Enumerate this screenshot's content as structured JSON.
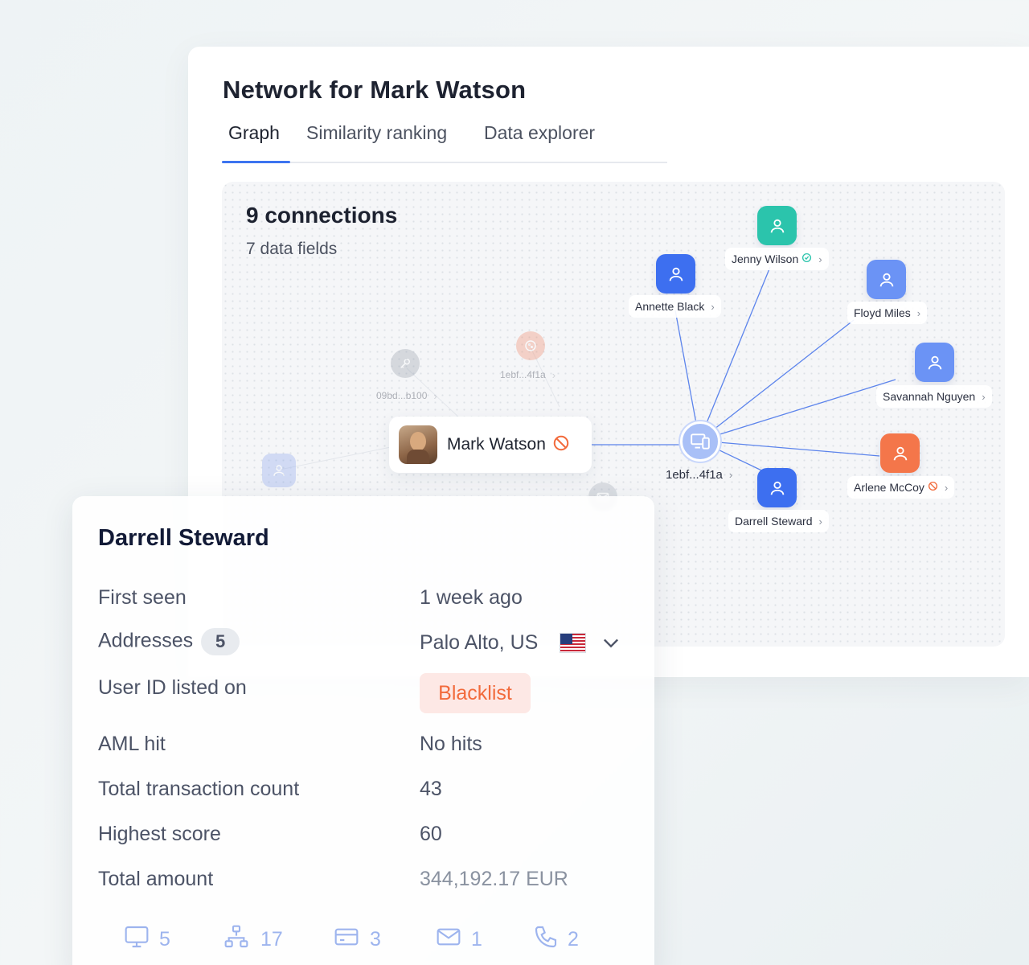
{
  "header": {
    "title": "Network for Mark Watson"
  },
  "tabs": [
    {
      "label": "Graph",
      "active": true
    },
    {
      "label": "Similarity ranking",
      "active": false
    },
    {
      "label": "Data explorer",
      "active": false
    }
  ],
  "graph": {
    "connections_title": "9 connections",
    "data_fields": "7 data fields",
    "center": {
      "name": "Mark Watson",
      "status_icon": "blocked-icon"
    },
    "hub": {
      "label": "1ebf...4f1a",
      "icon": "devices-icon"
    },
    "faded_nodes": [
      {
        "label": "09bd...b100",
        "icon": "key-icon"
      },
      {
        "label": "1ebf...4f1a",
        "icon": "cookie-icon"
      }
    ],
    "nodes": [
      {
        "name": "Jenny Wilson",
        "color": "#2bc4ac",
        "status": "verified"
      },
      {
        "name": "Annette Black",
        "color": "#3d6ff0",
        "status": ""
      },
      {
        "name": "Floyd Miles",
        "color": "#6b93f5",
        "status": ""
      },
      {
        "name": "Savannah Nguyen",
        "color": "#6b93f5",
        "status": ""
      },
      {
        "name": "Arlene McCoy",
        "color": "#f4764a",
        "status": "blocked"
      },
      {
        "name": "Darrell Steward",
        "color": "#3d6ff0",
        "status": ""
      }
    ]
  },
  "details": {
    "title": "Darrell Steward",
    "first_seen_label": "First seen",
    "first_seen_value": "1 week ago",
    "addresses_label": "Addresses",
    "addresses_count": "5",
    "addresses_value": "Palo Alto, US",
    "userid_label": "User ID listed on",
    "userid_value": "Blacklist",
    "aml_label": "AML hit",
    "aml_value": "No hits",
    "tx_count_label": "Total transaction count",
    "tx_count_value": "43",
    "score_label": "Highest score",
    "score_value": "60",
    "amount_label": "Total amount",
    "amount_value": "344,192.17 EUR",
    "stats": [
      {
        "icon": "monitor-icon",
        "value": "5"
      },
      {
        "icon": "network-icon",
        "value": "17"
      },
      {
        "icon": "card-icon",
        "value": "3"
      },
      {
        "icon": "mail-icon",
        "value": "1"
      },
      {
        "icon": "phone-icon",
        "value": "2"
      }
    ]
  },
  "colors": {
    "accent": "#3d74f0",
    "danger": "#f26a3b",
    "teal": "#2bc4ac"
  }
}
